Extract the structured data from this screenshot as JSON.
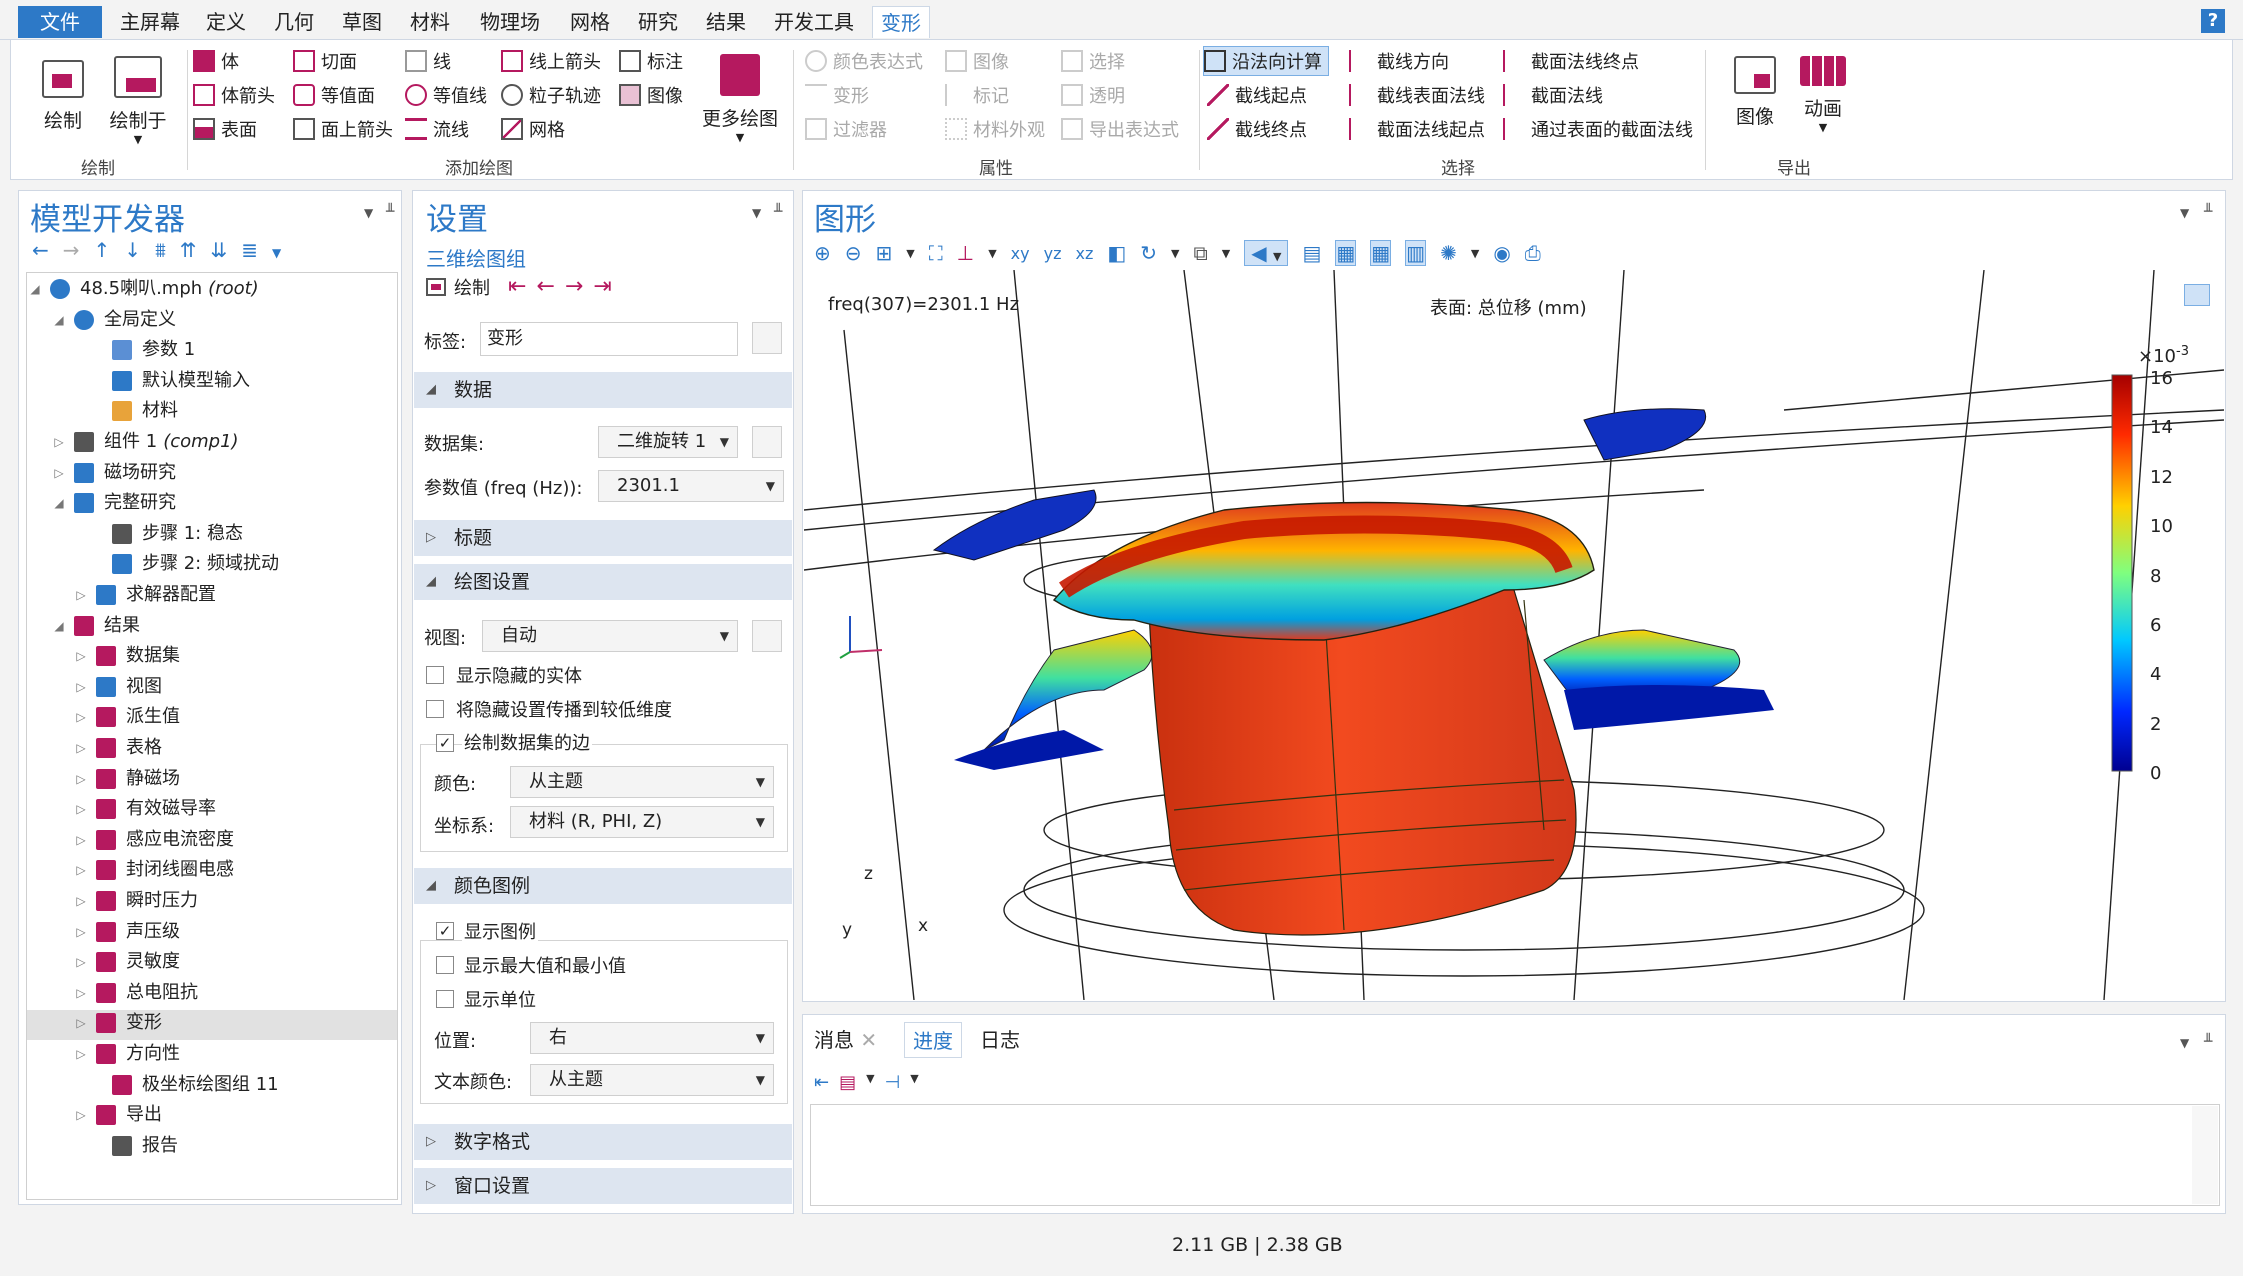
{
  "menu": {
    "file": "文件",
    "items": [
      "主屏幕",
      "定义",
      "几何",
      "草图",
      "材料",
      "物理场",
      "网格",
      "研究",
      "结果",
      "开发工具",
      "变形"
    ],
    "help": "?"
  },
  "ribbon": {
    "plot_group": {
      "plot": "绘制",
      "plot_in": "绘制于",
      "label": "绘制"
    },
    "add_plot": {
      "col1": [
        "体",
        "体箭头",
        "表面"
      ],
      "col2": [
        "切面",
        "等值面",
        "面上箭头"
      ],
      "col3": [
        "线",
        "等值线",
        "流线"
      ],
      "col4": [
        "线上箭头",
        "粒子轨迹",
        "网格"
      ],
      "col5": [
        "标注",
        "图像"
      ],
      "more": "更多绘图",
      "label": "添加绘图"
    },
    "attributes": {
      "col1": [
        "颜色表达式",
        "变形",
        "过滤器"
      ],
      "col2": [
        "图像",
        "标记",
        "材料外观"
      ],
      "col3": [
        "选择",
        "透明",
        "导出表达式"
      ],
      "label": "属性"
    },
    "selection": {
      "col1": [
        "沿法向计算",
        "截线起点",
        "截线终点"
      ],
      "col2": [
        "截线方向",
        "截线表面法线",
        "截面法线起点"
      ],
      "col3": [
        "截面法线终点",
        "截面法线",
        "通过表面的截面法线"
      ],
      "label": "选择"
    },
    "export": {
      "image": "图像",
      "animation": "动画",
      "label": "导出"
    }
  },
  "model_builder": {
    "title": "模型开发器",
    "tree": [
      {
        "label": "48.5喇叭.mph",
        "extra": "(root)"
      },
      {
        "label": "全局定义"
      },
      {
        "label": "参数 1"
      },
      {
        "label": "默认模型输入"
      },
      {
        "label": "材料"
      },
      {
        "label": "组件 1",
        "extra": "(comp1)"
      },
      {
        "label": "磁场研究"
      },
      {
        "label": "完整研究"
      },
      {
        "label": "步骤 1: 稳态"
      },
      {
        "label": "步骤 2: 频域扰动"
      },
      {
        "label": "求解器配置"
      },
      {
        "label": "结果"
      },
      {
        "label": "数据集"
      },
      {
        "label": "视图"
      },
      {
        "label": "派生值"
      },
      {
        "label": "表格"
      },
      {
        "label": "静磁场"
      },
      {
        "label": "有效磁导率"
      },
      {
        "label": "感应电流密度"
      },
      {
        "label": "封闭线圈电感"
      },
      {
        "label": "瞬时压力"
      },
      {
        "label": "声压级"
      },
      {
        "label": "灵敏度"
      },
      {
        "label": "总电阻抗"
      },
      {
        "label": "变形"
      },
      {
        "label": "方向性"
      },
      {
        "label": "极坐标绘图组 11"
      },
      {
        "label": "导出"
      },
      {
        "label": "报告"
      }
    ]
  },
  "settings": {
    "title": "设置",
    "subtitle": "三维绘图组",
    "plot": "绘制",
    "label_field": {
      "label": "标签:",
      "value": "变形"
    },
    "data_section": "数据",
    "dataset": {
      "label": "数据集:",
      "value": "二维旋转 1"
    },
    "param": {
      "label": "参数值 (freq (Hz)):",
      "value": "2301.1"
    },
    "title_section": "标题",
    "plot_settings_section": "绘图设置",
    "view": {
      "label": "视图:",
      "value": "自动"
    },
    "show_hidden": "显示隐藏的实体",
    "propagate_hidden": "将隐藏设置传播到较低维度",
    "draw_edges": "绘制数据集的边",
    "color": {
      "label": "颜色:",
      "value": "从主题"
    },
    "coord": {
      "label": "坐标系:",
      "value": "材料  (R, PHI, Z)"
    },
    "legend_section": "颜色图例",
    "show_legend": "显示图例",
    "show_minmax": "显示最大值和最小值",
    "show_units": "显示单位",
    "position": {
      "label": "位置:",
      "value": "右"
    },
    "text_color": {
      "label": "文本颜色:",
      "value": "从主题"
    },
    "number_format_section": "数字格式",
    "window_section": "窗口设置"
  },
  "graphics": {
    "title": "图形",
    "freq_text": "freq(307)=2301.1 Hz",
    "surface_text": "表面: 总位移 (mm)",
    "colorbar": {
      "exponent": "×10",
      "exp_power": "-3",
      "ticks": [
        "16",
        "14",
        "12",
        "10",
        "8",
        "6",
        "4",
        "2",
        "0"
      ]
    },
    "axes": {
      "z": "z",
      "y": "y",
      "x": "x"
    }
  },
  "messages": {
    "tabs": [
      "消息",
      "进度",
      "日志"
    ]
  },
  "status": {
    "memory": "2.11 GB | 2.38 GB"
  },
  "colors": {
    "accent": "#2d79c7",
    "section_bg": "#dde5f0",
    "plot_red": "#e03a1e",
    "magenta": "#b5195f"
  }
}
